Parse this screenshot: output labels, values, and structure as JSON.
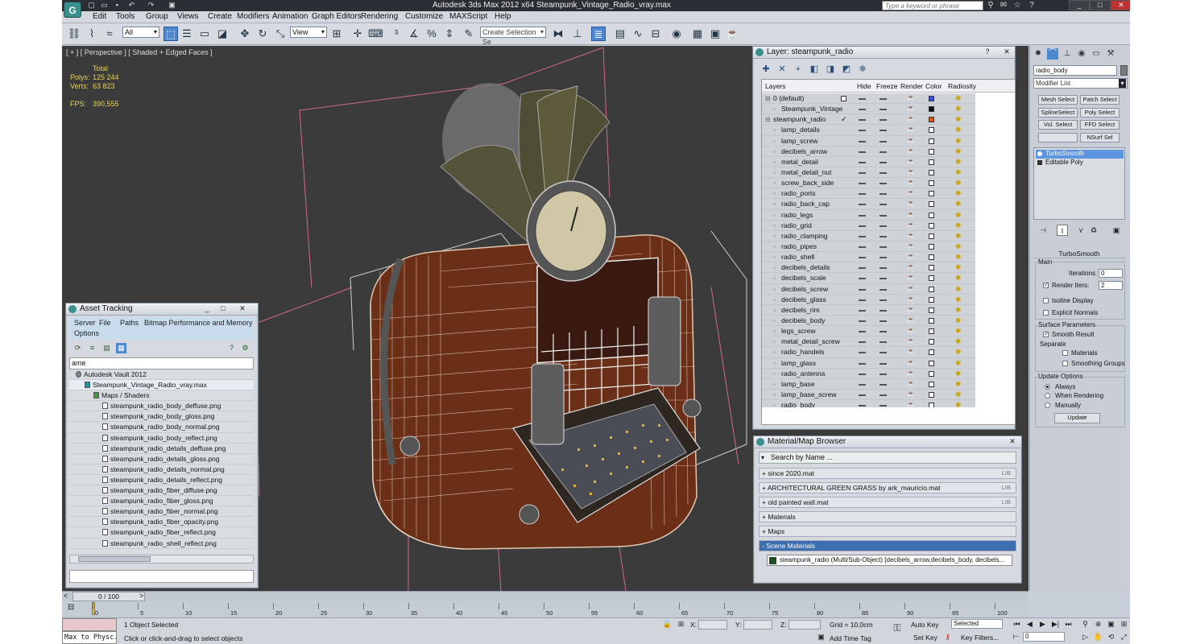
{
  "app": {
    "title": "Autodesk 3ds Max  2012 x64      Steampunk_Vintage_Radio_vray.max",
    "logo": "G",
    "search_placeholder": "Type a keyword or phrase"
  },
  "menu": [
    "Edit",
    "Tools",
    "Group",
    "Views",
    "Create",
    "Modifiers",
    "Animation",
    "Graph Editors",
    "Rendering",
    "Customize",
    "MAXScript",
    "Help"
  ],
  "toolbar": {
    "filter_value": "All",
    "refcoord_value": "View",
    "selection_set_placeholder": "Create Selection Se"
  },
  "viewport": {
    "label": "[ + ] [ Perspective ] [ Shaded + Edged Faces ]",
    "stats_header": "Total",
    "polys_label": "Polys:",
    "polys_value": "125 244",
    "verts_label": "Verts:",
    "verts_value": "63 823",
    "fps_label": "FPS:",
    "fps_value": "390,555"
  },
  "asset_tracking": {
    "title": "Asset Tracking",
    "menu": [
      "Server",
      "File",
      "Paths",
      "Bitmap Performance and Memory",
      "Options"
    ],
    "column_header": "ame",
    "tree": [
      {
        "label": "Autodesk Vault 2012",
        "level": 0
      },
      {
        "label": "Steampunk_Vintage_Radio_vray.max",
        "level": 1
      },
      {
        "label": "Maps / Shaders",
        "level": 2
      },
      {
        "label": "steampunk_radio_body_deffuse.png",
        "level": 3
      },
      {
        "label": "steampunk_radio_body_gloss.png",
        "level": 3
      },
      {
        "label": "steampunk_radio_body_normal.png",
        "level": 3
      },
      {
        "label": "steampunk_radio_body_reflect.png",
        "level": 3
      },
      {
        "label": "steampunk_radio_details_deffuse.png",
        "level": 3
      },
      {
        "label": "steampunk_radio_details_gloss.png",
        "level": 3
      },
      {
        "label": "steampunk_radio_details_normal.png",
        "level": 3
      },
      {
        "label": "steampunk_radio_details_reflect.png",
        "level": 3
      },
      {
        "label": "steampunk_radio_fiber_diffuse.png",
        "level": 3
      },
      {
        "label": "steampunk_radio_fiber_gloss.png",
        "level": 3
      },
      {
        "label": "steampunk_radio_fiber_normal.png",
        "level": 3
      },
      {
        "label": "steampunk_radio_fiber_opacity.png",
        "level": 3
      },
      {
        "label": "steampunk_radio_fiber_reflect.png",
        "level": 3
      },
      {
        "label": "steampunk_radio_shell_reflect.png",
        "level": 3
      }
    ]
  },
  "layer_window": {
    "title": "Layer: steampunk_radio",
    "columns": {
      "layers": "Layers",
      "hide": "Hide",
      "freeze": "Freeze",
      "render": "Render",
      "color": "Color",
      "radiosity": "Radiosity"
    },
    "rows": [
      {
        "name": "0 (default)",
        "level": 0,
        "color": "#3b4fd8"
      },
      {
        "name": "Steampunk_Vintage",
        "level": 1,
        "color": "#111111"
      },
      {
        "name": "steampunk_radio",
        "level": 0,
        "color": "#d35a1c",
        "current": "✓"
      },
      {
        "name": "lamp_details",
        "level": 1,
        "color": "#ffffff"
      },
      {
        "name": "lamp_screw",
        "level": 1,
        "color": "#ffffff"
      },
      {
        "name": "decibels_arrow",
        "level": 1,
        "color": "#ffffff"
      },
      {
        "name": "metal_detail",
        "level": 1,
        "color": "#ffffff"
      },
      {
        "name": "metal_detail_nut",
        "level": 1,
        "color": "#ffffff"
      },
      {
        "name": "screw_back_side",
        "level": 1,
        "color": "#ffffff"
      },
      {
        "name": "radio_ports",
        "level": 1,
        "color": "#ffffff"
      },
      {
        "name": "radio_back_cap",
        "level": 1,
        "color": "#ffffff"
      },
      {
        "name": "radio_legs",
        "level": 1,
        "color": "#ffffff"
      },
      {
        "name": "radio_grid",
        "level": 1,
        "color": "#ffffff"
      },
      {
        "name": "radio_clamping",
        "level": 1,
        "color": "#ffffff"
      },
      {
        "name": "radio_pipes",
        "level": 1,
        "color": "#ffffff"
      },
      {
        "name": "radio_shell",
        "level": 1,
        "color": "#ffffff"
      },
      {
        "name": "decibels_details",
        "level": 1,
        "color": "#ffffff"
      },
      {
        "name": "decibels_scale",
        "level": 1,
        "color": "#ffffff"
      },
      {
        "name": "decibels_screw",
        "level": 1,
        "color": "#ffffff"
      },
      {
        "name": "decibels_glass",
        "level": 1,
        "color": "#ffffff"
      },
      {
        "name": "decibels_rim",
        "level": 1,
        "color": "#ffffff"
      },
      {
        "name": "decibels_body",
        "level": 1,
        "color": "#ffffff"
      },
      {
        "name": "legs_screw",
        "level": 1,
        "color": "#ffffff"
      },
      {
        "name": "metal_detail_screw",
        "level": 1,
        "color": "#ffffff"
      },
      {
        "name": "radio_handels",
        "level": 1,
        "color": "#ffffff"
      },
      {
        "name": "lamp_glass",
        "level": 1,
        "color": "#ffffff"
      },
      {
        "name": "radio_antenna",
        "level": 1,
        "color": "#ffffff"
      },
      {
        "name": "lamp_base",
        "level": 1,
        "color": "#ffffff"
      },
      {
        "name": "lamp_base_screw",
        "level": 1,
        "color": "#ffffff"
      },
      {
        "name": "radio_body",
        "level": 1,
        "color": "#ffffff"
      }
    ]
  },
  "material_browser": {
    "title": "Material/Map Browser",
    "search_placeholder": "Search by Name ...",
    "groups": [
      {
        "label": "+ since 2020.mat",
        "lib": "LIB",
        "open": false
      },
      {
        "label": "+ ARCHITECTURAL GREEN GRASS by ark_mauricio.mat",
        "lib": "LIB",
        "open": false
      },
      {
        "label": "+ old painted wall.mat",
        "lib": "LIB",
        "open": false
      },
      {
        "label": "+ Materials",
        "lib": "",
        "open": false
      },
      {
        "label": "+ Maps",
        "lib": "",
        "open": false
      },
      {
        "label": "- Scene Materials",
        "lib": "",
        "open": true
      }
    ],
    "scene_item": "steampunk_radio (Multi/Sub-Object) [decibels_arrow,decibels_body, decibels..."
  },
  "command_panel": {
    "object_name": "radio_body",
    "modifier_list": "Modifier List",
    "buttons": [
      "Mesh Select",
      "Patch Select",
      "SplineSelect",
      "Poly Select",
      "Vol. Select",
      "FFD Select",
      "",
      "NSurf Sel"
    ],
    "stack": [
      "TurboSmooth",
      "Editable Poly"
    ],
    "turbosmooth": {
      "title": "TurboSmooth",
      "main_label": "Main",
      "iterations_label": "Iterations:",
      "iterations_value": "0",
      "render_iters_label": "Render Iters:",
      "render_iters_value": "2",
      "isoline_label": "Isoline Display",
      "explicit_label": "Explicit Normals",
      "surface_label": "Surface Parameters",
      "smooth_result_label": "Smooth Result",
      "separate_label": "Separate",
      "materials_label": "Materials",
      "smoothing_groups_label": "Smoothing Groups",
      "update_options_label": "Update Options",
      "always_label": "Always",
      "when_rendering_label": "When Rendering",
      "manually_label": "Manually",
      "update_button": "Update"
    }
  },
  "timeline": {
    "frame_display": "0 / 100",
    "ticks": [
      "0",
      "5",
      "10",
      "15",
      "20",
      "25",
      "30",
      "35",
      "40",
      "45",
      "50",
      "55",
      "60",
      "65",
      "70",
      "75",
      "80",
      "85",
      "90",
      "95",
      "100"
    ]
  },
  "status": {
    "maxscript_text": "Max to Physc.",
    "selection_text": "1 Object Selected",
    "prompt_text": "Click or click-and-drag to select objects",
    "x_label": "X:",
    "y_label": "Y:",
    "z_label": "Z:",
    "grid_text": "Grid = 10,0cm",
    "add_time_tag": "Add Time Tag",
    "auto_key": "Auto Key",
    "set_key": "Set Key",
    "selected_value": "Selected",
    "key_filters": "Key Filters...",
    "frame_value": "0"
  }
}
